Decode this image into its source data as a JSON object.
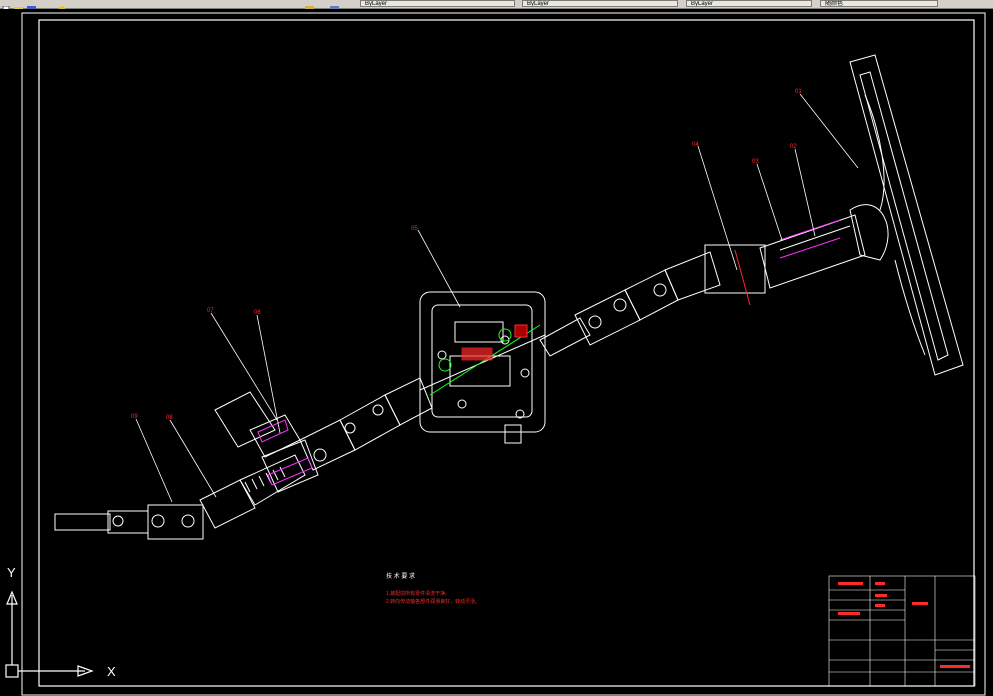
{
  "toolbar": {
    "tabs": [
      {
        "label": "ByLayer"
      },
      {
        "label": "ByLayer"
      },
      {
        "label": "ByLayer"
      },
      {
        "label": "随颜色"
      }
    ]
  },
  "drawing": {
    "callouts": [
      "01",
      "02",
      "03",
      "04",
      "05",
      "06",
      "07",
      "08",
      "09"
    ],
    "tech_title": "技 术 要 求",
    "tech_notes": [
      "1.装配前所有零件清洗干净。",
      "2.转向传动轴各部件润滑良好，转动灵活。"
    ]
  },
  "ucs": {
    "x_label": "X",
    "y_label": "Y"
  },
  "colors": {
    "border": "#ffffff",
    "callout": "#ff2a2a",
    "green": "#19ff19",
    "magenta": "#ff33ff"
  }
}
